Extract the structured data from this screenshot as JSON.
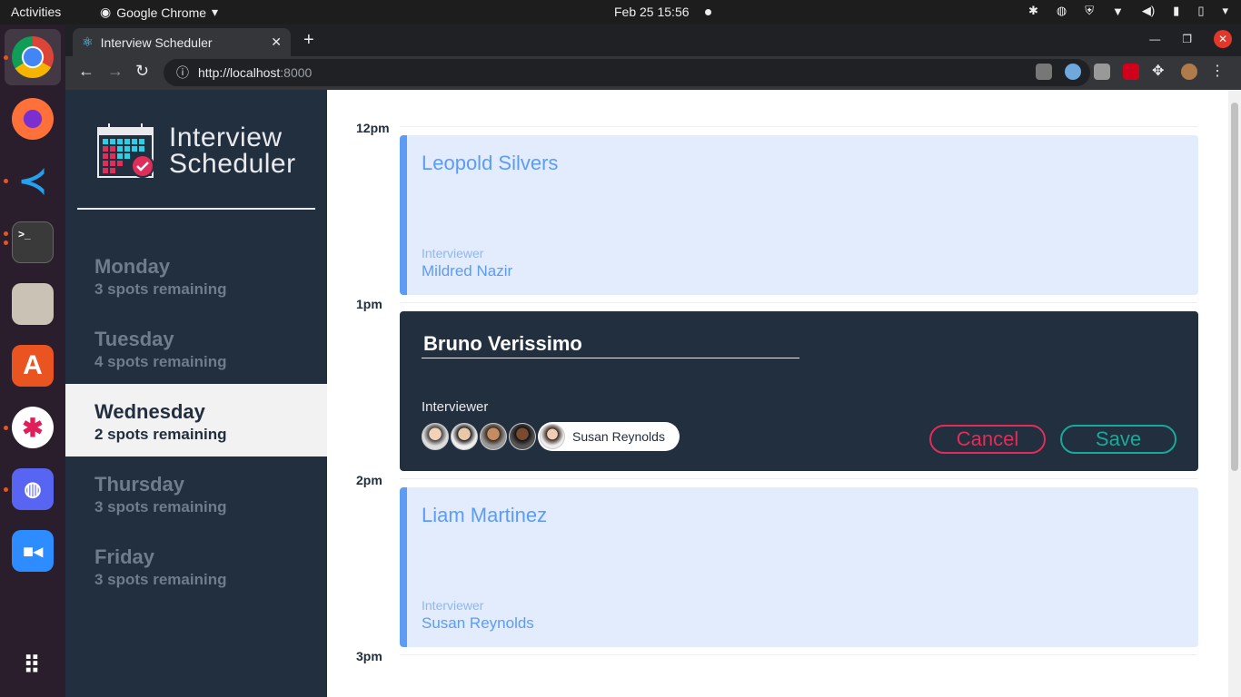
{
  "system": {
    "activities": "Activities",
    "app_menu": "Google Chrome",
    "clock": "Feb 25  15:56"
  },
  "browser": {
    "tab_title": "Interview Scheduler",
    "url_host": "http://localhost",
    "url_port": ":8000"
  },
  "app": {
    "brand": {
      "line1": "Interview",
      "line2": "Scheduler"
    },
    "days": [
      {
        "name": "Monday",
        "spots": "3 spots remaining",
        "selected": false
      },
      {
        "name": "Tuesday",
        "spots": "4 spots remaining",
        "selected": false
      },
      {
        "name": "Wednesday",
        "spots": "2 spots remaining",
        "selected": true
      },
      {
        "name": "Thursday",
        "spots": "3 spots remaining",
        "selected": false
      },
      {
        "name": "Friday",
        "spots": "3 spots remaining",
        "selected": false
      }
    ],
    "hours": [
      "12pm",
      "1pm",
      "2pm",
      "3pm"
    ],
    "appointments": [
      {
        "student": "Leopold Silvers",
        "interviewer_label": "Interviewer",
        "interviewer": "Mildred Nazir"
      },
      {
        "student": "Liam Martinez",
        "interviewer_label": "Interviewer",
        "interviewer": "Susan Reynolds"
      }
    ],
    "form": {
      "student_value": "Bruno Verissimo",
      "interviewer_label": "Interviewer",
      "selected_interviewer": "Susan Reynolds",
      "cancel_label": "Cancel",
      "save_label": "Save"
    }
  }
}
